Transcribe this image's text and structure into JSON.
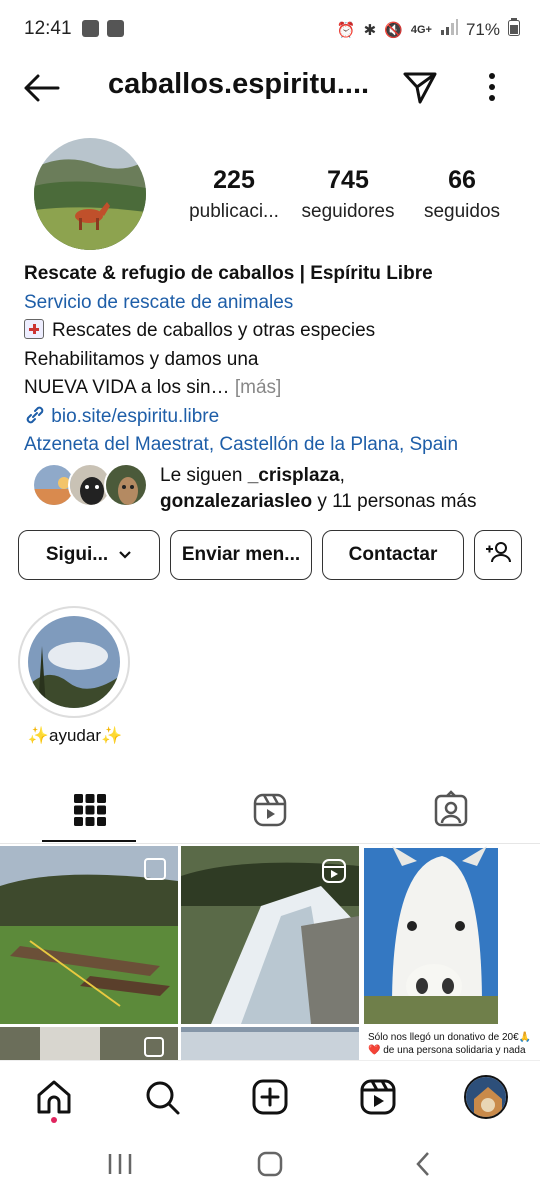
{
  "status_bar": {
    "time": "12:41",
    "network": "4G+",
    "battery": "71%"
  },
  "header": {
    "username": "caballos.espiritu....",
    "back_icon": "arrow-left-icon",
    "send_icon": "paper-plane-icon",
    "more_icon": "more-vertical-icon"
  },
  "stats": {
    "posts_count": "225",
    "posts_label": "publicaci...",
    "followers_count": "745",
    "followers_label": "seguidores",
    "following_count": "66",
    "following_label": "seguidos"
  },
  "bio": {
    "name": "Rescate & refugio de caballos | Espíritu Libre",
    "category": "Servicio de rescate de animales",
    "line1": "Rescates de caballos y otras especies",
    "line2": "Rehabilitamos y damos una",
    "line3": "NUEVA VIDA a los sin…",
    "more": "[más]",
    "link": "bio.site/espiritu.libre",
    "location": "Atzeneta del Maestrat, Castellón de la Plana, Spain"
  },
  "mutual": {
    "prefix": "Le siguen ",
    "user1": "_crisplaza",
    "sep": ",",
    "user2": "gonzalezariasleo",
    "suffix": " y 11 personas más"
  },
  "buttons": {
    "following": "Sigui...",
    "message": "Enviar men...",
    "contact": "Contactar"
  },
  "highlight": {
    "label": "✨ayudar✨"
  },
  "grid": {
    "caption_line1": "Sólo nos llegó un donativo de 20€🙏",
    "caption_line2": "❤️ de una persona solidaria  y nada"
  },
  "colors": {
    "link_blue": "#1e5ea8",
    "notification_dot": "#e0245e"
  }
}
